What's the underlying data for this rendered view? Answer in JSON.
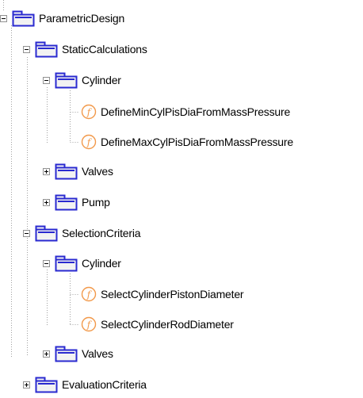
{
  "tree": {
    "root": {
      "label": "ParametricDesign",
      "icon": "package-icon",
      "expanded": true,
      "children": {
        "static_calculations": {
          "label": "StaticCalculations",
          "icon": "package-icon",
          "expanded": true,
          "children": {
            "cylinder": {
              "label": "Cylinder",
              "icon": "package-icon",
              "expanded": true,
              "functions": [
                {
                  "label": "DefineMinCylPisDiaFromMassPressure",
                  "icon": "function-icon"
                },
                {
                  "label": "DefineMaxCylPisDiaFromMassPressure",
                  "icon": "function-icon"
                }
              ]
            },
            "valves": {
              "label": "Valves",
              "icon": "package-icon",
              "expanded": false
            },
            "pump": {
              "label": "Pump",
              "icon": "package-icon",
              "expanded": false
            }
          }
        },
        "selection_criteria": {
          "label": "SelectionCriteria",
          "icon": "package-icon",
          "expanded": true,
          "children": {
            "cylinder": {
              "label": "Cylinder",
              "icon": "package-icon",
              "expanded": true,
              "functions": [
                {
                  "label": "SelectCylinderPistonDiameter",
                  "icon": "function-icon"
                },
                {
                  "label": "SelectCylinderRodDiameter",
                  "icon": "function-icon"
                }
              ]
            },
            "valves": {
              "label": "Valves",
              "icon": "package-icon",
              "expanded": false
            }
          }
        },
        "evaluation_criteria": {
          "label": "EvaluationCriteria",
          "icon": "package-icon",
          "expanded": false
        }
      }
    }
  },
  "colors": {
    "package_stroke": "#2a2ad0",
    "package_fill": "#f2f2f2",
    "function_stroke": "#f2994a",
    "connector": "#a0a0a0",
    "toggle_border": "#919191"
  }
}
